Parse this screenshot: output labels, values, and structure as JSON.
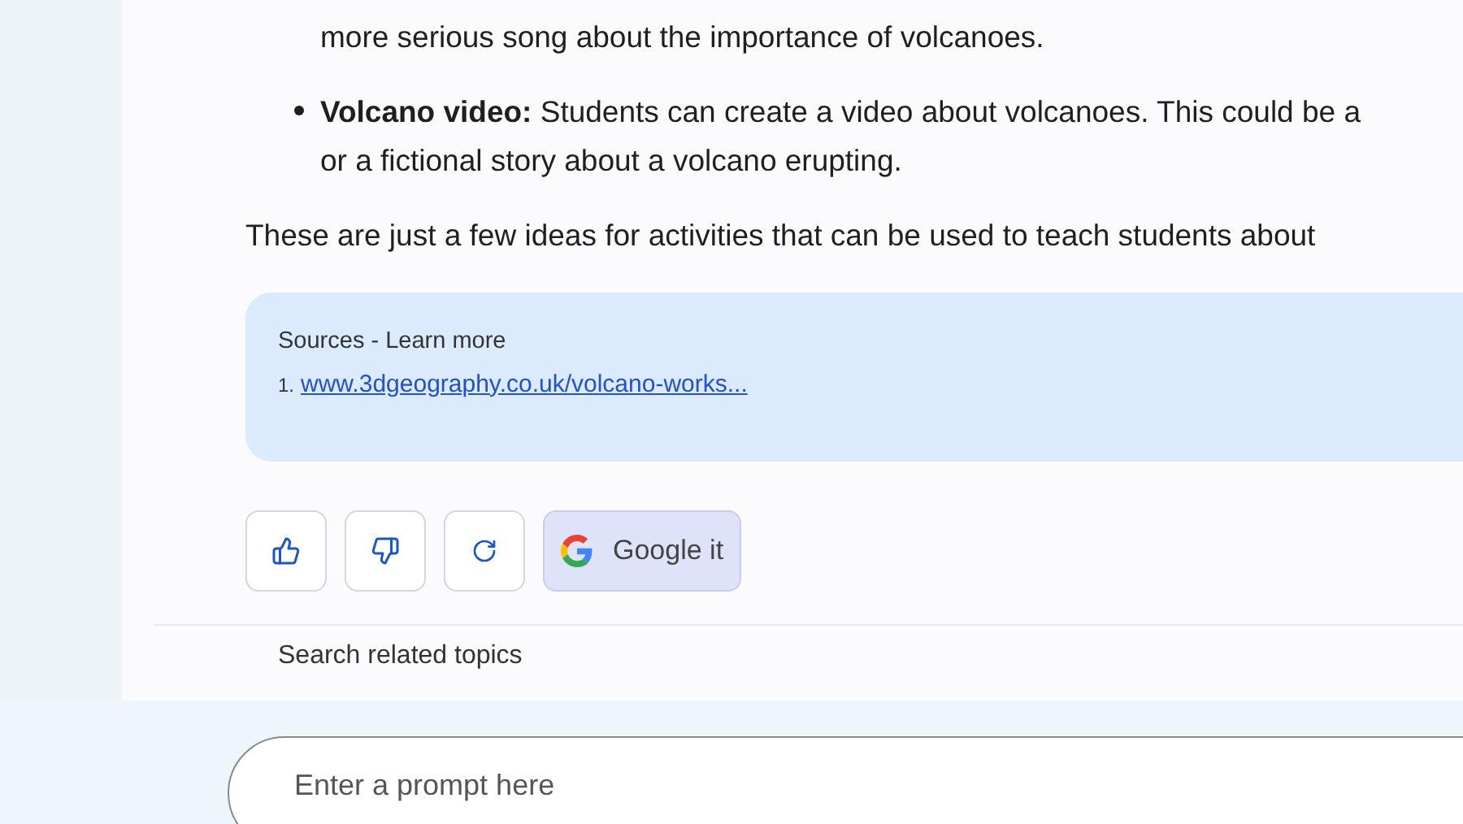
{
  "bullets": [
    {
      "continuation": "more serious song about the importance of volcanoes.",
      "show_marker": false
    },
    {
      "continuation": "**Volcano video:** Students can create a video about volcanoes. This could be a",
      "extra": "or a fictional story about a volcano erupting.",
      "show_marker": true
    }
  ],
  "summary": "These are just a few ideas for activities that can be used to teach students about",
  "sources": {
    "heading": "Sources - Learn more",
    "items": [
      {
        "number": "1.",
        "link": "www.3dgeography.co.uk/volcano-works..."
      }
    ]
  },
  "actions": [
    {
      "kind": "thumbs-up"
    },
    {
      "kind": "thumbs-down"
    },
    {
      "kind": "regenerate"
    },
    {
      "kind": "google",
      "label": "Google it"
    }
  ],
  "related_heading": "Search related topics",
  "prompt": {
    "placeholder": "Enter a prompt here"
  }
}
